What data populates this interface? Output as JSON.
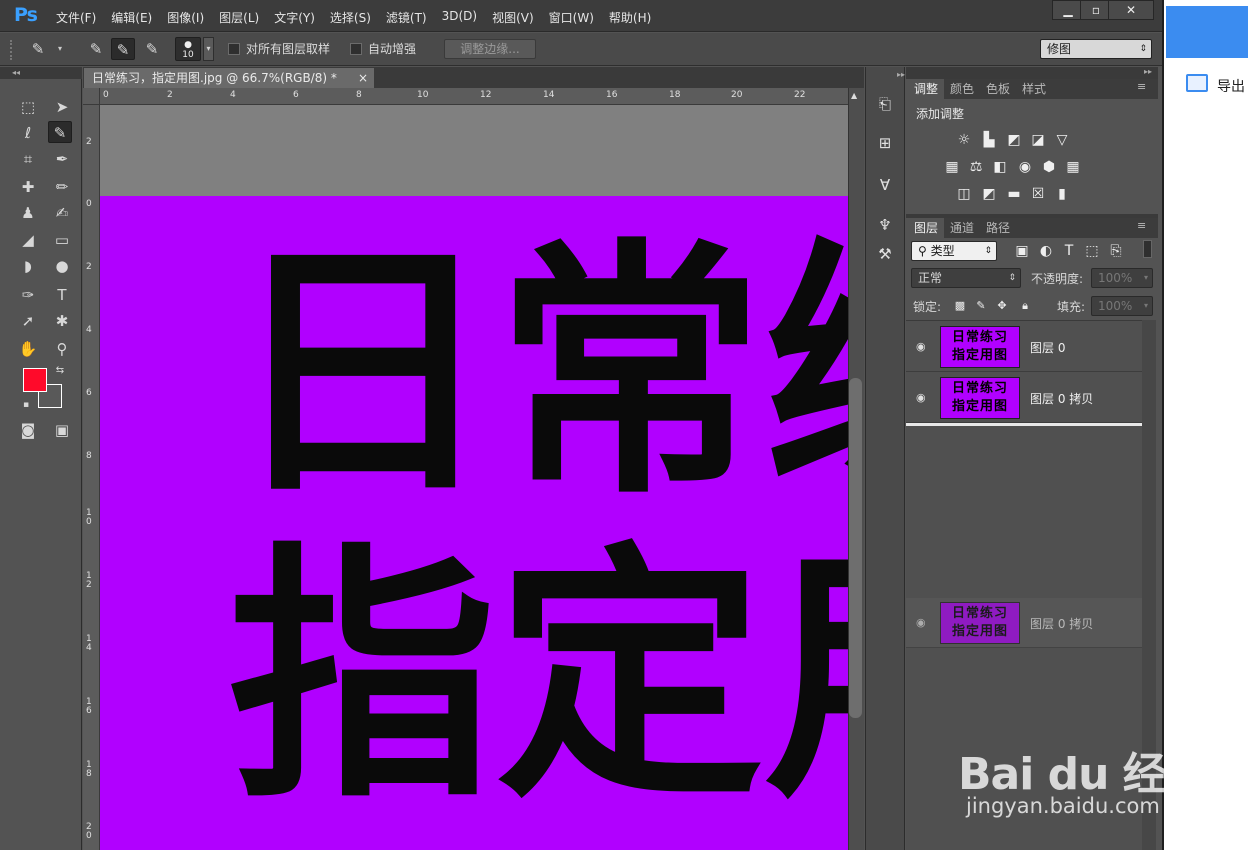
{
  "app": {
    "logo": "Ps",
    "menu": [
      "文件(F)",
      "编辑(E)",
      "图像(I)",
      "图层(L)",
      "文字(Y)",
      "选择(S)",
      "滤镜(T)",
      "3D(D)",
      "视图(V)",
      "窗口(W)",
      "帮助(H)"
    ],
    "window_buttons": {
      "minimize": "▁",
      "maximize": "▫",
      "close": "✕"
    }
  },
  "options": {
    "brush_size": "10",
    "sample_all_layers_label": "对所有图层取样",
    "auto_enhance_label": "自动增强",
    "refine_edge_label": "调整边缘...",
    "workspace": "修图"
  },
  "document": {
    "tab_title": "日常练习，指定用图.jpg @ 66.7%(RGB/8) *",
    "tab_close": "×",
    "ruler_top_ticks": [
      "0",
      "2",
      "4",
      "6",
      "8",
      "10",
      "12",
      "14",
      "16",
      "18",
      "20",
      "22"
    ],
    "ruler_left_ticks": [
      "2",
      "0",
      "2",
      "4",
      "6",
      "8",
      "1 0",
      "1 2",
      "1 4",
      "1 6",
      "1 8",
      "2 0"
    ],
    "canvas_text": [
      "日",
      "常",
      "练",
      "指",
      "定",
      "用"
    ],
    "canvas_color": "#b100ff"
  },
  "tools": {
    "foreground_color": "#ff0a2a",
    "background_color": "#595959"
  },
  "panels": {
    "adjust_tabs": [
      "调整",
      "颜色",
      "色板",
      "样式"
    ],
    "add_adjustment": "添加调整",
    "layers_tabs": [
      "图层",
      "通道",
      "路径"
    ],
    "kind_filter": "类型",
    "blend_mode": "正常",
    "opacity_label": "不透明度:",
    "opacity_value": "100%",
    "lock_label": "锁定:",
    "fill_label": "填充:",
    "fill_value": "100%",
    "thumb_text_line1": "日常练习",
    "thumb_text_line2": "指定用图",
    "layers": [
      {
        "name": "图层 0"
      },
      {
        "name": "图层 0 拷贝"
      }
    ],
    "dragging_layer": {
      "name": "图层 0 拷贝"
    }
  },
  "outside_window": {
    "export_label": "导出"
  },
  "watermark": {
    "brand": "Bai du 经验",
    "url": "jingyan.baidu.com"
  }
}
